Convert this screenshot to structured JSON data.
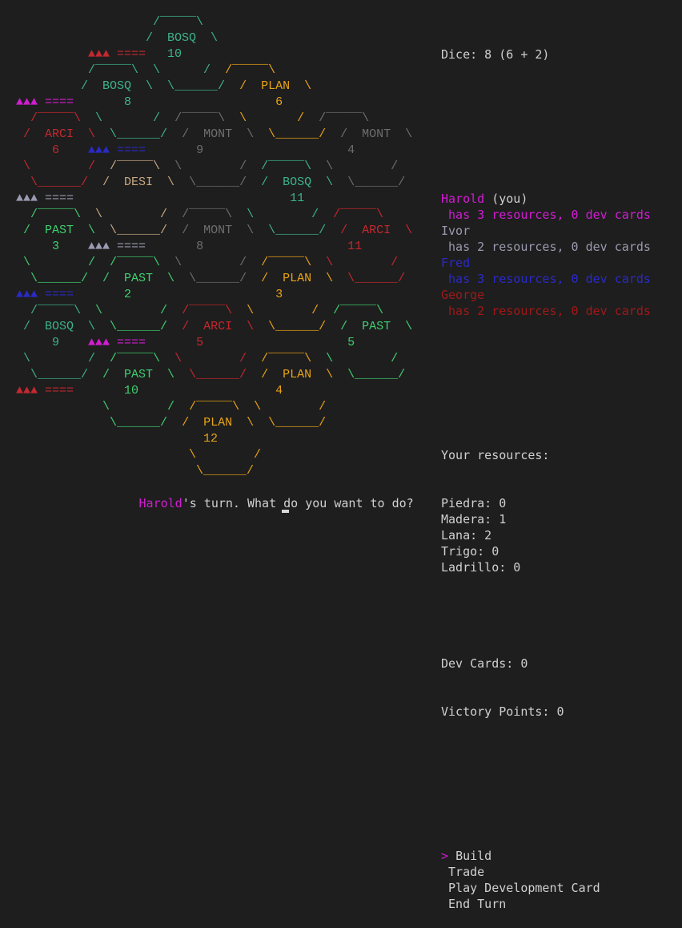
{
  "colors": {
    "default": "#d0d0d0",
    "bosq": "#3db38a",
    "plan": "#e8a317",
    "mont": "#6e6e6e",
    "arci": "#c4282f",
    "desi": "#c8a882",
    "past": "#3fcf6f",
    "harold": "#d21cd2",
    "ivor": "#9a9ab0",
    "fred": "#2a2ac8",
    "george": "#a01818"
  },
  "board_rows": [
    [
      {
        "t": "                   ",
        "c": "default"
      },
      {
        "t": "/‾‾‾‾‾\\",
        "c": "bosq"
      }
    ],
    [
      {
        "t": "                  ",
        "c": "default"
      },
      {
        "t": "/  BOSQ  \\",
        "c": "bosq"
      }
    ],
    [
      {
        "t": "          ",
        "c": "default"
      },
      {
        "t": "▲▲▲ ====",
        "c": "arci"
      },
      {
        "t": "   ",
        "c": "default"
      },
      {
        "t": "10",
        "c": "bosq"
      }
    ],
    [
      {
        "t": "          ",
        "c": "default"
      },
      {
        "t": "/‾‾‾‾‾\\  \\",
        "c": "bosq"
      },
      {
        "t": "      ",
        "c": "default"
      },
      {
        "t": "/  ",
        "c": "bosq"
      },
      {
        "t": "/‾‾‾‾‾\\",
        "c": "plan"
      }
    ],
    [
      {
        "t": "         ",
        "c": "default"
      },
      {
        "t": "/  BOSQ  \\  \\______/  ",
        "c": "bosq"
      },
      {
        "t": "/  PLAN  \\",
        "c": "plan"
      }
    ],
    [
      {
        "t": "▲▲▲ ====",
        "c": "harold"
      },
      {
        "t": "       ",
        "c": "default"
      },
      {
        "t": "8",
        "c": "bosq"
      },
      {
        "t": "                    ",
        "c": "default"
      },
      {
        "t": "6",
        "c": "plan"
      }
    ],
    [
      {
        "t": "  ",
        "c": "default"
      },
      {
        "t": "/‾‾‾‾‾\\",
        "c": "arci"
      },
      {
        "t": "  ",
        "c": "default"
      },
      {
        "t": "\\       /",
        "c": "bosq"
      },
      {
        "t": "  ",
        "c": "default"
      },
      {
        "t": "/‾‾‾‾‾\\",
        "c": "mont"
      },
      {
        "t": "  ",
        "c": "default"
      },
      {
        "t": "\\       /",
        "c": "plan"
      },
      {
        "t": "  ",
        "c": "default"
      },
      {
        "t": "/‾‾‾‾‾\\",
        "c": "mont"
      }
    ],
    [
      {
        "t": " ",
        "c": "default"
      },
      {
        "t": "/  ARCI  \\",
        "c": "arci"
      },
      {
        "t": "  ",
        "c": "default"
      },
      {
        "t": "\\______/",
        "c": "bosq"
      },
      {
        "t": "  ",
        "c": "default"
      },
      {
        "t": "/  MONT  \\",
        "c": "mont"
      },
      {
        "t": "  ",
        "c": "default"
      },
      {
        "t": "\\______/",
        "c": "plan"
      },
      {
        "t": "  ",
        "c": "default"
      },
      {
        "t": "/  MONT  \\",
        "c": "mont"
      }
    ],
    [
      {
        "t": "     ",
        "c": "default"
      },
      {
        "t": "6",
        "c": "arci"
      },
      {
        "t": "    ",
        "c": "default"
      },
      {
        "t": "▲▲▲ ====",
        "c": "fred"
      },
      {
        "t": "       ",
        "c": "default"
      },
      {
        "t": "9",
        "c": "mont"
      },
      {
        "t": "                    ",
        "c": "default"
      },
      {
        "t": "4",
        "c": "mont"
      }
    ],
    [
      {
        "t": " ",
        "c": "default"
      },
      {
        "t": "\\        /",
        "c": "arci"
      },
      {
        "t": "  ",
        "c": "default"
      },
      {
        "t": "/‾‾‾‾‾\\",
        "c": "desi"
      },
      {
        "t": "  ",
        "c": "default"
      },
      {
        "t": "\\        /",
        "c": "mont"
      },
      {
        "t": "  ",
        "c": "default"
      },
      {
        "t": "/‾‾‾‾‾\\",
        "c": "bosq"
      },
      {
        "t": "  ",
        "c": "default"
      },
      {
        "t": "\\        /",
        "c": "mont"
      }
    ],
    [
      {
        "t": "  ",
        "c": "default"
      },
      {
        "t": "\\______/",
        "c": "arci"
      },
      {
        "t": "  ",
        "c": "default"
      },
      {
        "t": "/  DESI  \\",
        "c": "desi"
      },
      {
        "t": "  ",
        "c": "default"
      },
      {
        "t": "\\______/",
        "c": "mont"
      },
      {
        "t": "  ",
        "c": "default"
      },
      {
        "t": "/  BOSQ  \\",
        "c": "bosq"
      },
      {
        "t": "  ",
        "c": "default"
      },
      {
        "t": "\\______/",
        "c": "mont"
      }
    ],
    [
      {
        "t": "▲▲▲ ====",
        "c": "ivor"
      },
      {
        "t": "                              ",
        "c": "default"
      },
      {
        "t": "11",
        "c": "bosq"
      }
    ],
    [
      {
        "t": "  ",
        "c": "default"
      },
      {
        "t": "/‾‾‾‾‾\\",
        "c": "past"
      },
      {
        "t": "  ",
        "c": "default"
      },
      {
        "t": "\\        /",
        "c": "desi"
      },
      {
        "t": "  ",
        "c": "default"
      },
      {
        "t": "/‾‾‾‾‾\\",
        "c": "mont"
      },
      {
        "t": "  ",
        "c": "default"
      },
      {
        "t": "\\        /",
        "c": "bosq"
      },
      {
        "t": "  ",
        "c": "default"
      },
      {
        "t": "/‾‾‾‾‾\\",
        "c": "arci"
      }
    ],
    [
      {
        "t": " ",
        "c": "default"
      },
      {
        "t": "/  PAST  \\",
        "c": "past"
      },
      {
        "t": "  ",
        "c": "default"
      },
      {
        "t": "\\______/",
        "c": "desi"
      },
      {
        "t": "  ",
        "c": "default"
      },
      {
        "t": "/  MONT  \\",
        "c": "mont"
      },
      {
        "t": "  ",
        "c": "default"
      },
      {
        "t": "\\______/",
        "c": "bosq"
      },
      {
        "t": "  ",
        "c": "default"
      },
      {
        "t": "/  ARCI  \\",
        "c": "arci"
      }
    ],
    [
      {
        "t": "     ",
        "c": "default"
      },
      {
        "t": "3",
        "c": "past"
      },
      {
        "t": "    ",
        "c": "default"
      },
      {
        "t": "▲▲▲ ====",
        "c": "ivor"
      },
      {
        "t": "       ",
        "c": "default"
      },
      {
        "t": "8",
        "c": "mont"
      },
      {
        "t": "                    ",
        "c": "default"
      },
      {
        "t": "11",
        "c": "arci"
      }
    ],
    [
      {
        "t": " ",
        "c": "default"
      },
      {
        "t": "\\        /",
        "c": "past"
      },
      {
        "t": "  ",
        "c": "default"
      },
      {
        "t": "/‾‾‾‾‾\\",
        "c": "past"
      },
      {
        "t": "  ",
        "c": "default"
      },
      {
        "t": "\\        /",
        "c": "mont"
      },
      {
        "t": "  ",
        "c": "default"
      },
      {
        "t": "/‾‾‾‾‾\\",
        "c": "plan"
      },
      {
        "t": "  ",
        "c": "default"
      },
      {
        "t": "\\        /",
        "c": "arci"
      }
    ],
    [
      {
        "t": "  ",
        "c": "default"
      },
      {
        "t": "\\______/",
        "c": "past"
      },
      {
        "t": "  ",
        "c": "default"
      },
      {
        "t": "/  PAST  \\",
        "c": "past"
      },
      {
        "t": "  ",
        "c": "default"
      },
      {
        "t": "\\______/",
        "c": "mont"
      },
      {
        "t": "  ",
        "c": "default"
      },
      {
        "t": "/  PLAN  \\",
        "c": "plan"
      },
      {
        "t": "  ",
        "c": "default"
      },
      {
        "t": "\\______/",
        "c": "arci"
      }
    ],
    [
      {
        "t": "▲▲▲ ====",
        "c": "fred"
      },
      {
        "t": "       ",
        "c": "default"
      },
      {
        "t": "2",
        "c": "past"
      },
      {
        "t": "                    ",
        "c": "default"
      },
      {
        "t": "3",
        "c": "plan"
      }
    ],
    [
      {
        "t": "  ",
        "c": "default"
      },
      {
        "t": "/‾‾‾‾‾\\",
        "c": "bosq"
      },
      {
        "t": "  ",
        "c": "default"
      },
      {
        "t": "\\        /",
        "c": "past"
      },
      {
        "t": "  ",
        "c": "default"
      },
      {
        "t": "/‾‾‾‾‾\\",
        "c": "arci"
      },
      {
        "t": "  ",
        "c": "default"
      },
      {
        "t": "\\        /",
        "c": "plan"
      },
      {
        "t": "  ",
        "c": "default"
      },
      {
        "t": "/‾‾‾‾‾\\",
        "c": "past"
      }
    ],
    [
      {
        "t": " ",
        "c": "default"
      },
      {
        "t": "/  BOSQ  \\",
        "c": "bosq"
      },
      {
        "t": "  ",
        "c": "default"
      },
      {
        "t": "\\______/",
        "c": "past"
      },
      {
        "t": "  ",
        "c": "default"
      },
      {
        "t": "/  ARCI  \\",
        "c": "arci"
      },
      {
        "t": "  ",
        "c": "default"
      },
      {
        "t": "\\______/",
        "c": "plan"
      },
      {
        "t": "  ",
        "c": "default"
      },
      {
        "t": "/  PAST  \\",
        "c": "past"
      }
    ],
    [
      {
        "t": "     ",
        "c": "default"
      },
      {
        "t": "9",
        "c": "bosq"
      },
      {
        "t": "    ",
        "c": "default"
      },
      {
        "t": "▲▲▲ ====",
        "c": "harold"
      },
      {
        "t": "       ",
        "c": "default"
      },
      {
        "t": "5",
        "c": "arci"
      },
      {
        "t": "                    ",
        "c": "default"
      },
      {
        "t": "5",
        "c": "past"
      }
    ],
    [
      {
        "t": " ",
        "c": "default"
      },
      {
        "t": "\\        /",
        "c": "bosq"
      },
      {
        "t": "  ",
        "c": "default"
      },
      {
        "t": "/‾‾‾‾‾\\",
        "c": "past"
      },
      {
        "t": "  ",
        "c": "default"
      },
      {
        "t": "\\        /",
        "c": "arci"
      },
      {
        "t": "  ",
        "c": "default"
      },
      {
        "t": "/‾‾‾‾‾\\",
        "c": "plan"
      },
      {
        "t": "  ",
        "c": "default"
      },
      {
        "t": "\\        /",
        "c": "past"
      }
    ],
    [
      {
        "t": "  ",
        "c": "default"
      },
      {
        "t": "\\______/",
        "c": "bosq"
      },
      {
        "t": "  ",
        "c": "default"
      },
      {
        "t": "/  PAST  \\",
        "c": "past"
      },
      {
        "t": "  ",
        "c": "default"
      },
      {
        "t": "\\______/",
        "c": "arci"
      },
      {
        "t": "  ",
        "c": "default"
      },
      {
        "t": "/  PLAN  \\",
        "c": "plan"
      },
      {
        "t": "  ",
        "c": "default"
      },
      {
        "t": "\\______/",
        "c": "past"
      }
    ],
    [
      {
        "t": "▲▲▲ ====",
        "c": "arci"
      },
      {
        "t": "       ",
        "c": "default"
      },
      {
        "t": "10",
        "c": "past"
      },
      {
        "t": "                   ",
        "c": "default"
      },
      {
        "t": "4",
        "c": "plan"
      }
    ],
    [
      {
        "t": "            ",
        "c": "default"
      },
      {
        "t": "\\        /",
        "c": "past"
      },
      {
        "t": "  ",
        "c": "default"
      },
      {
        "t": "/‾‾‾‾‾\\",
        "c": "plan"
      },
      {
        "t": "  ",
        "c": "default"
      },
      {
        "t": "\\        /",
        "c": "plan"
      }
    ],
    [
      {
        "t": "             ",
        "c": "default"
      },
      {
        "t": "\\______/",
        "c": "past"
      },
      {
        "t": "  ",
        "c": "default"
      },
      {
        "t": "/  PLAN  \\",
        "c": "plan"
      },
      {
        "t": "  ",
        "c": "default"
      },
      {
        "t": "\\______/",
        "c": "plan"
      }
    ],
    [
      {
        "t": "                          ",
        "c": "default"
      },
      {
        "t": "12",
        "c": "plan"
      }
    ],
    [
      {
        "t": "                        ",
        "c": "default"
      },
      {
        "t": "\\        /",
        "c": "plan"
      }
    ],
    [
      {
        "t": "                         ",
        "c": "default"
      },
      {
        "t": "\\______/",
        "c": "plan"
      }
    ]
  ],
  "dice": "Dice: 8 (6 + 2)",
  "players": [
    {
      "name": "Harold",
      "suffix": " (you)",
      "status": " has 3 resources, 0 dev cards",
      "color": "harold"
    },
    {
      "name": "Ivor",
      "suffix": "",
      "status": " has 2 resources, 0 dev cards",
      "color": "ivor"
    },
    {
      "name": "Fred",
      "suffix": "",
      "status": " has 3 resources, 0 dev cards",
      "color": "fred"
    },
    {
      "name": "George",
      "suffix": "",
      "status": " has 2 resources, 0 dev cards",
      "color": "george"
    }
  ],
  "resources_title": "Your resources:",
  "resources": [
    "Piedra: 0",
    "Madera: 1",
    "Lana: 2",
    "Trigo: 0",
    "Ladrillo: 0"
  ],
  "dev_cards": "Dev Cards: 0",
  "victory_points": "Victory Points: 0",
  "menu": {
    "pointer": "> ",
    "items": [
      "Build",
      "Trade",
      "Play Development Card",
      "End Turn"
    ]
  },
  "prompt": {
    "indent": "                 ",
    "name": "Harold",
    "text": "'s turn. What do you want to do?"
  }
}
